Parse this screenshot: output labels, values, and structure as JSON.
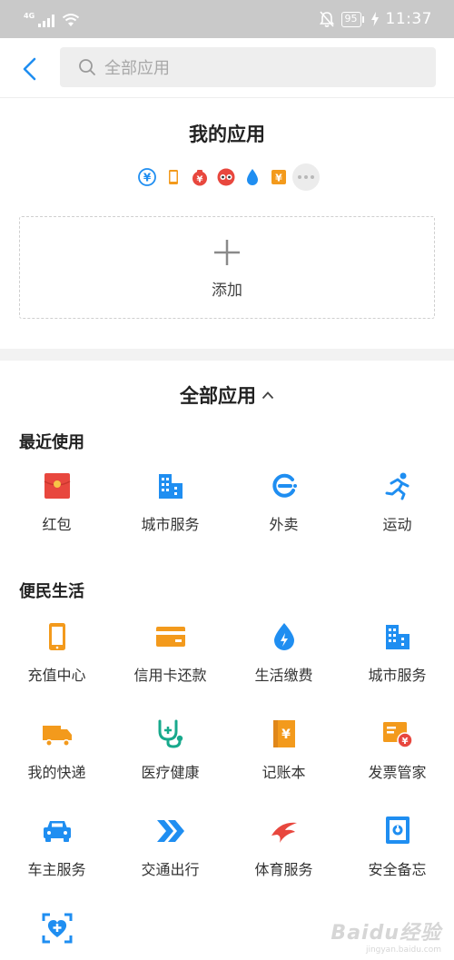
{
  "status_bar": {
    "network": "4G",
    "battery": "95",
    "time": "11:37"
  },
  "search": {
    "placeholder": "全部应用"
  },
  "my_apps": {
    "title": "我的应用",
    "icons": [
      "yuan-circle-icon",
      "phone-icon",
      "money-bag-icon",
      "red-glasses-icon",
      "water-drop-icon",
      "yang-icon"
    ],
    "add_label": "添加"
  },
  "all_apps": {
    "title": "全部应用",
    "sections": [
      {
        "title": "最近使用",
        "items": [
          {
            "label": "红包",
            "icon": "red-envelope-icon"
          },
          {
            "label": "城市服务",
            "icon": "city-building-icon"
          },
          {
            "label": "外卖",
            "icon": "takeout-icon"
          },
          {
            "label": "运动",
            "icon": "running-icon"
          }
        ]
      },
      {
        "title": "便民生活",
        "items": [
          {
            "label": "充值中心",
            "icon": "phone-recharge-icon"
          },
          {
            "label": "信用卡还款",
            "icon": "credit-card-icon"
          },
          {
            "label": "生活缴费",
            "icon": "utility-bill-icon"
          },
          {
            "label": "城市服务",
            "icon": "city-building-icon"
          },
          {
            "label": "我的快递",
            "icon": "delivery-truck-icon"
          },
          {
            "label": "医疗健康",
            "icon": "stethoscope-icon"
          },
          {
            "label": "记账本",
            "icon": "ledger-icon"
          },
          {
            "label": "发票管家",
            "icon": "invoice-icon"
          },
          {
            "label": "车主服务",
            "icon": "car-icon"
          },
          {
            "label": "交通出行",
            "icon": "transport-arrows-icon"
          },
          {
            "label": "体育服务",
            "icon": "sports-icon"
          },
          {
            "label": "安全备忘",
            "icon": "safe-box-icon"
          },
          {
            "label": "",
            "icon": "health-heart-icon"
          }
        ]
      }
    ]
  },
  "watermark": {
    "logo": "Baidu经验",
    "sub": "jingyan.baidu.com"
  },
  "colors": {
    "accent_blue": "#1f8ef1",
    "orange": "#f39a1c",
    "red": "#e8473e",
    "status_bar": "#c9c9c9"
  }
}
